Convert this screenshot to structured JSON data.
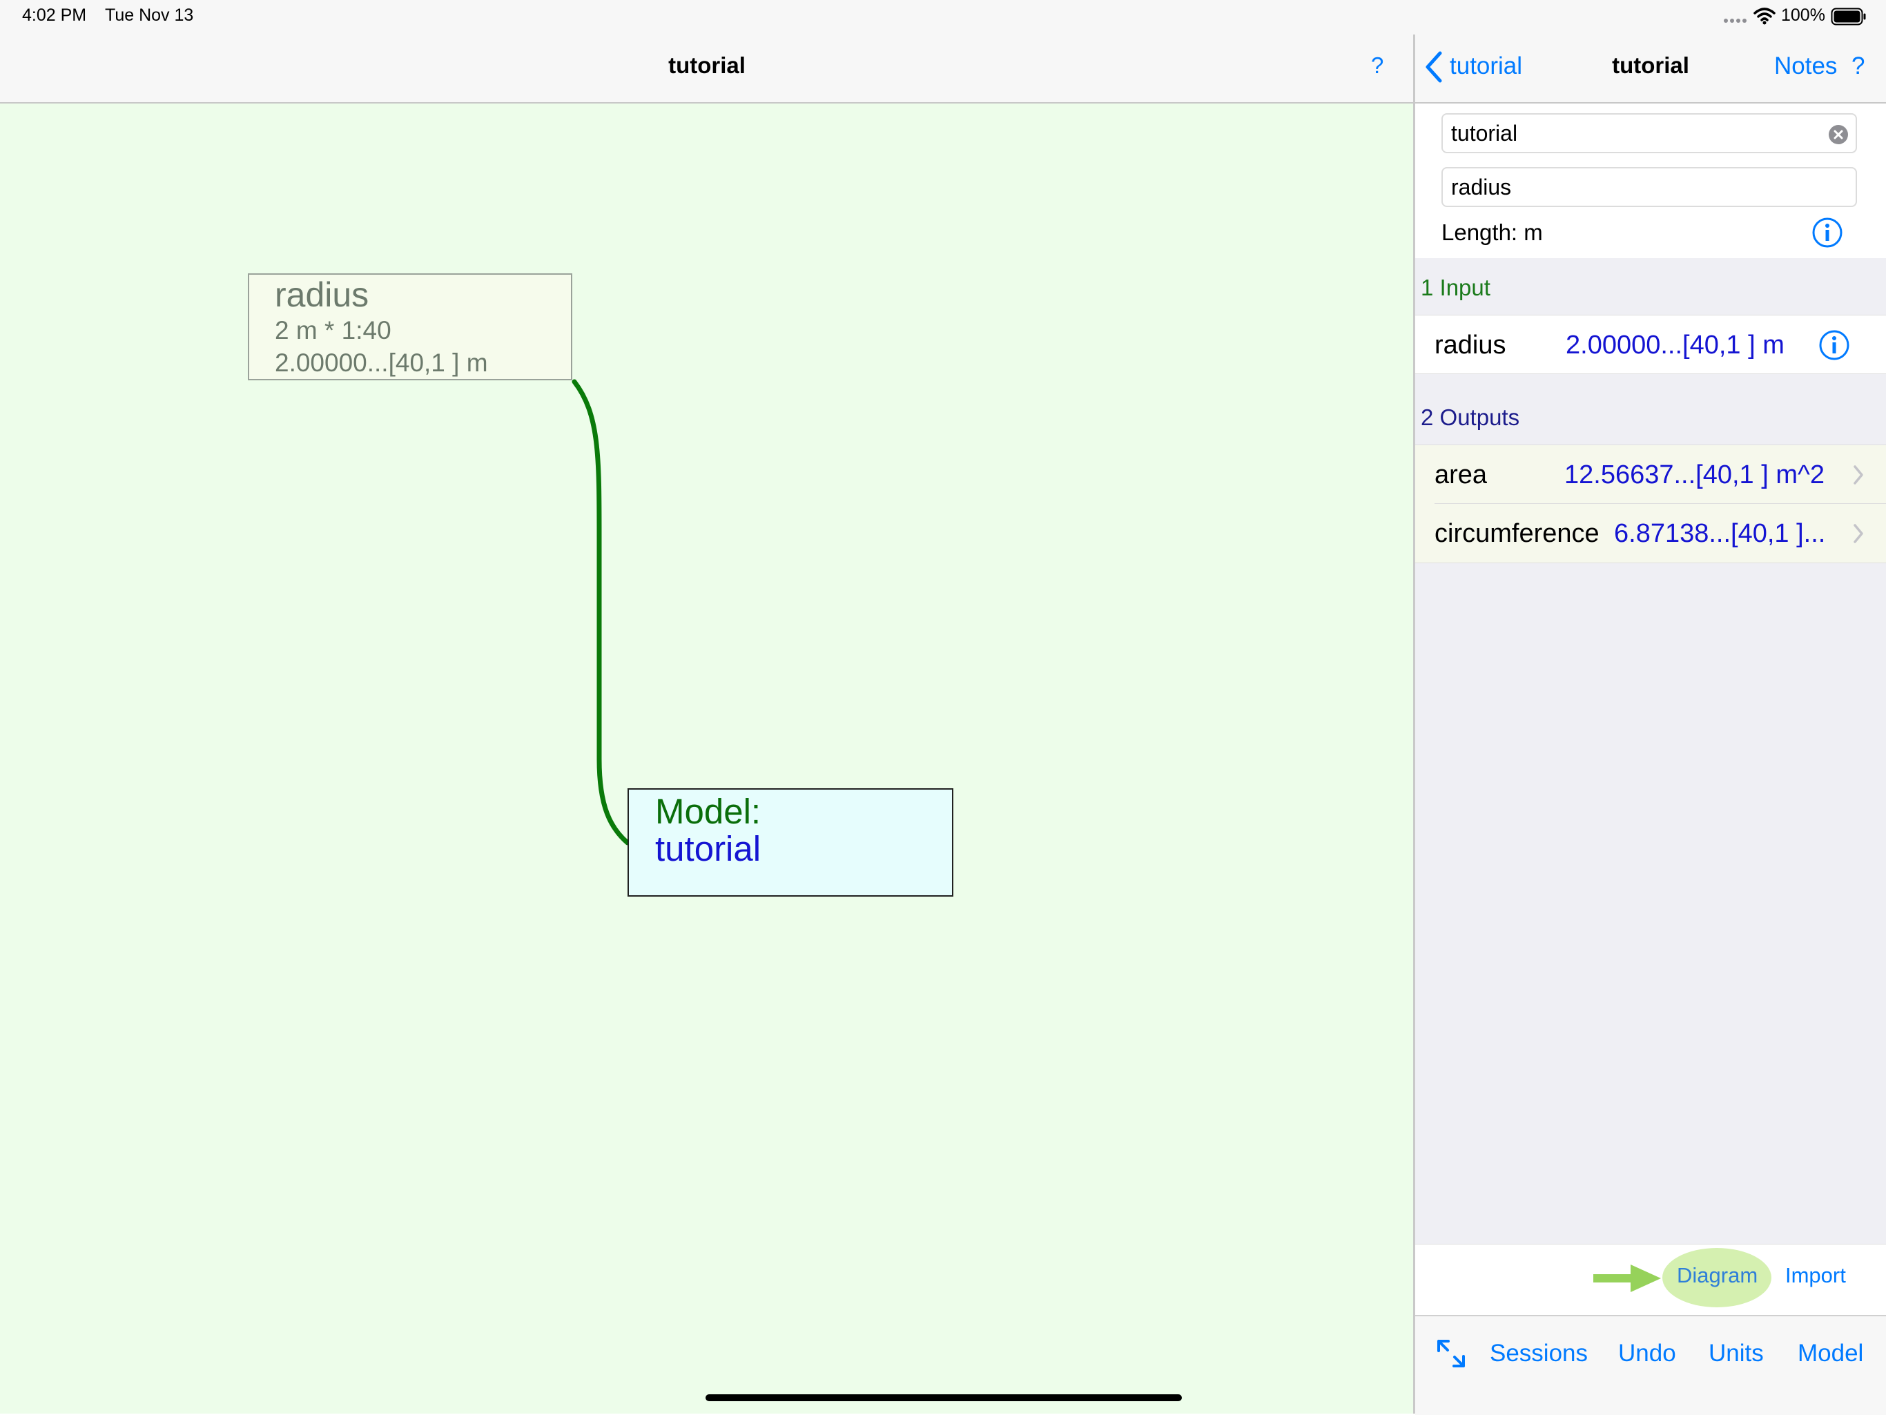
{
  "status_bar": {
    "time": "4:02 PM",
    "date": "Tue Nov 13",
    "battery": "100%"
  },
  "left": {
    "title": "tutorial",
    "help": "?",
    "nodes": {
      "radius": {
        "title": "radius",
        "line1": "2 m * 1:40",
        "line2": "2.00000...[40,1 ] m"
      },
      "model": {
        "label": "Model:",
        "name": "tutorial"
      }
    }
  },
  "right": {
    "nav": {
      "back_label": "tutorial",
      "title": "tutorial",
      "notes": "Notes",
      "help": "?"
    },
    "form": {
      "model_name_value": "tutorial",
      "variable_value": "radius",
      "length_label": "Length: m"
    },
    "inputs_header": "1 Input",
    "inputs": [
      {
        "name": "radius",
        "value": "2.00000...[40,1 ] m"
      }
    ],
    "outputs_header": "2 Outputs",
    "outputs": [
      {
        "name": "area",
        "value": "12.56637...[40,1 ] m^2"
      },
      {
        "name": "circumference",
        "value": "6.87138...[40,1 ]..."
      }
    ],
    "toolbar1": {
      "diagram": "Diagram",
      "import": "Import"
    },
    "toolbar2": {
      "sessions": "Sessions",
      "undo": "Undo",
      "units": "Units",
      "model": "Model"
    }
  },
  "colors": {
    "accent": "#007aff",
    "diagram_bg": "#edfdea",
    "connector": "#0a7a0a",
    "value_blue": "#1414d2",
    "input_header": "#1a7a1a",
    "output_header": "#1c1c8c",
    "highlight": "#d5f0b0",
    "highlight_arrow": "#96d25a"
  }
}
